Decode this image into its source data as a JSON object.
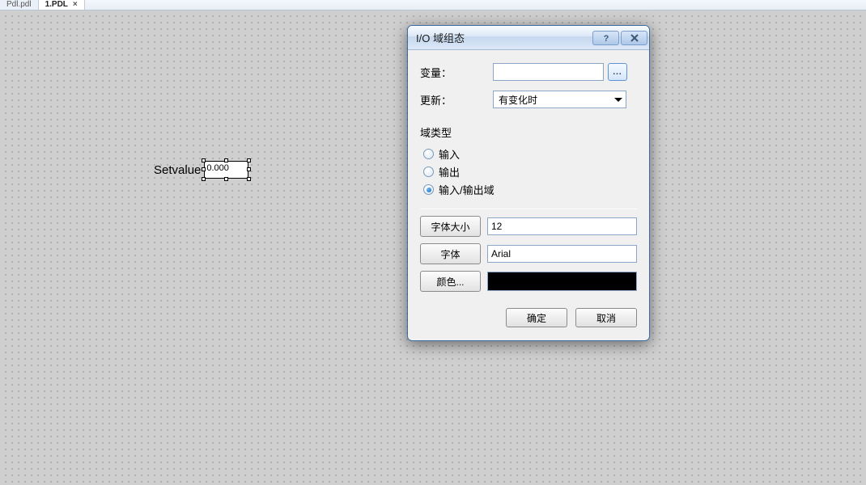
{
  "tabs": {
    "inactive_label": "Pdl.pdl",
    "active_label": "1.PDL",
    "close_glyph": "×"
  },
  "canvas": {
    "label_text": "Setvalue",
    "field_value": "0.000"
  },
  "dialog": {
    "title": "I/O 域组态",
    "help_tooltip": "?",
    "variable": {
      "label": "变量：",
      "value": "",
      "browse": "..."
    },
    "update": {
      "label": "更新：",
      "selected": "有变化时"
    },
    "field_type": {
      "group_label": "域类型",
      "options": {
        "input": "输入",
        "output": "输出",
        "inout": "输入/输出域"
      },
      "selected": "inout"
    },
    "font_size": {
      "button": "字体大小",
      "value": "12"
    },
    "font": {
      "button": "字体",
      "value": "Arial"
    },
    "color": {
      "button": "颜色...",
      "value": "#000000"
    },
    "buttons": {
      "ok": "确定",
      "cancel": "取消"
    }
  }
}
